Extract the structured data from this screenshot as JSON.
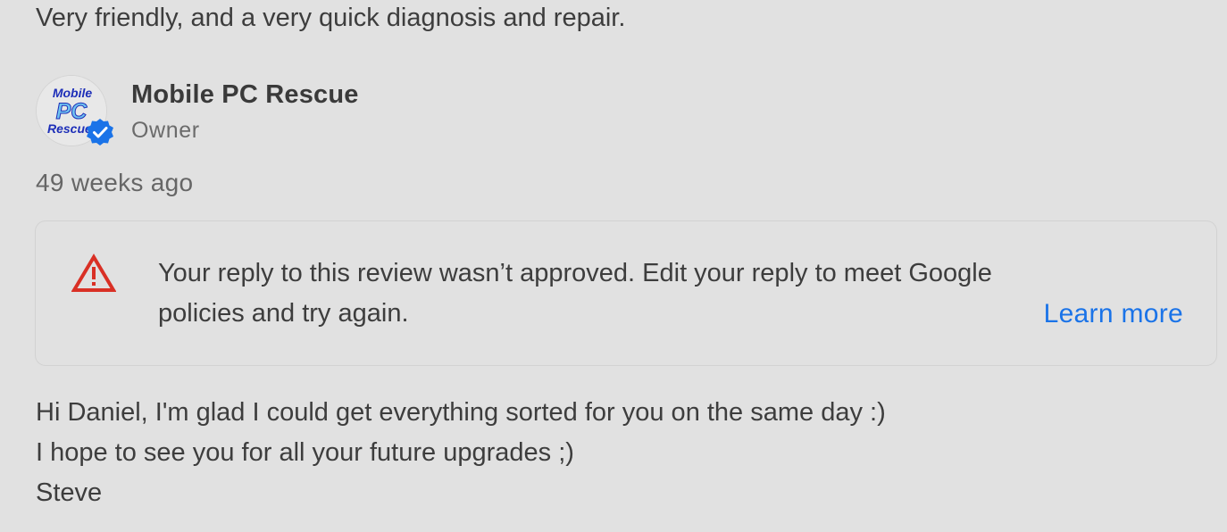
{
  "review": {
    "text": "Very friendly, and a very quick diagnosis and repair."
  },
  "owner": {
    "name": "Mobile PC Rescue",
    "role": "Owner",
    "avatar_text": [
      "Mobile",
      "PC",
      "Rescue"
    ],
    "verified_icon": "verified-badge-icon",
    "verified_color": "#1a73e8"
  },
  "reply": {
    "time_ago": "49 weeks ago",
    "notice": {
      "icon": "warning-triangle-icon",
      "icon_color": "#d93025",
      "message": "Your reply to this review wasn’t approved. Edit your reply to meet Google policies and try again.",
      "link_label": "Learn more",
      "link_color": "#1a73e8"
    },
    "lines": [
      "Hi Daniel, I'm glad I could get everything sorted for you on the same day :)",
      "I hope to see you for all your future upgrades ;)",
      "Steve"
    ]
  }
}
